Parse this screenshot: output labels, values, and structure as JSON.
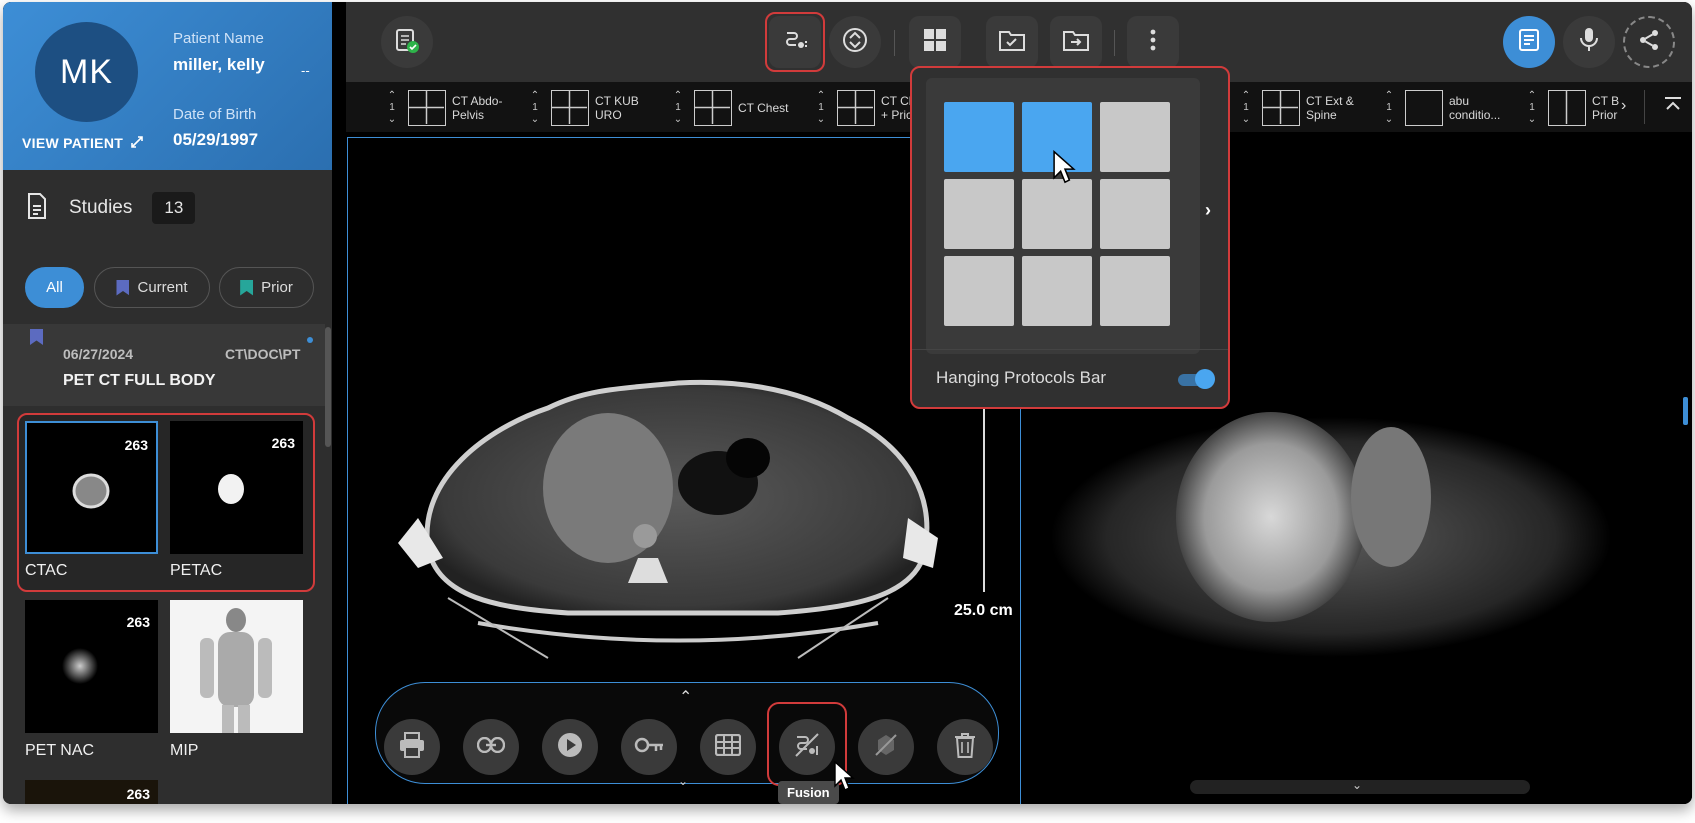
{
  "patient": {
    "initials": "MK",
    "name_label": "Patient Name",
    "name": "miller, kelly",
    "name_extra": "--",
    "dob_label": "Date of Birth",
    "dob": "05/29/1997",
    "view_label": "VIEW PATIENT"
  },
  "studies": {
    "label": "Studies",
    "count": "13",
    "filters": {
      "all": "All",
      "current": "Current",
      "prior": "Prior"
    },
    "item": {
      "date": "06/27/2024",
      "modality": "CT\\DOC\\PT",
      "title": "PET CT FULL BODY"
    },
    "series": [
      {
        "label": "CTAC",
        "count": "263"
      },
      {
        "label": "PETAC",
        "count": "263"
      },
      {
        "label": "PET NAC",
        "count": "263"
      },
      {
        "label": "MIP",
        "count": ""
      },
      {
        "label": "",
        "count": "263"
      }
    ]
  },
  "protocols": [
    {
      "label1": "CT Abdo-",
      "label2": "Pelvis",
      "num": "1"
    },
    {
      "label1": "CT KUB",
      "label2": "URO",
      "num": "1"
    },
    {
      "label1": "CT Chest",
      "label2": "",
      "num": "1"
    },
    {
      "label1": "CT Ch",
      "label2": "+ Pric",
      "num": "1"
    },
    {
      "label1": "CT Ext &",
      "label2": "Spine",
      "num": "1"
    },
    {
      "label1": "abu",
      "label2": "conditio...",
      "num": "1"
    },
    {
      "label1": "CT B",
      "label2": "Prior",
      "num": "1"
    }
  ],
  "viewer": {
    "ruler_label": "25.0 cm",
    "tooltip": "Fusion"
  },
  "layout_popup": {
    "toggle_label": "Hanging Protocols Bar",
    "toggle_on": true,
    "selected_cells": 2
  },
  "colors": {
    "accent": "#3d8ed6",
    "highlight_red": "#d13b3b",
    "bookmark_current": "#5c6bc0",
    "bookmark_prior": "#26a69a"
  },
  "icons": {
    "toolbar": [
      "clipboard-check-icon",
      "fusion-icon",
      "scroll-sync-icon",
      "layout-grid-icon",
      "folder-check-icon",
      "folder-export-icon",
      "more-vert-icon",
      "report-icon",
      "microphone-icon",
      "share-icon"
    ],
    "floating": [
      "print-icon",
      "link-icon",
      "play-icon",
      "key-icon",
      "table-icon",
      "fusion-icon",
      "no-annotation-icon",
      "trash-icon"
    ]
  }
}
